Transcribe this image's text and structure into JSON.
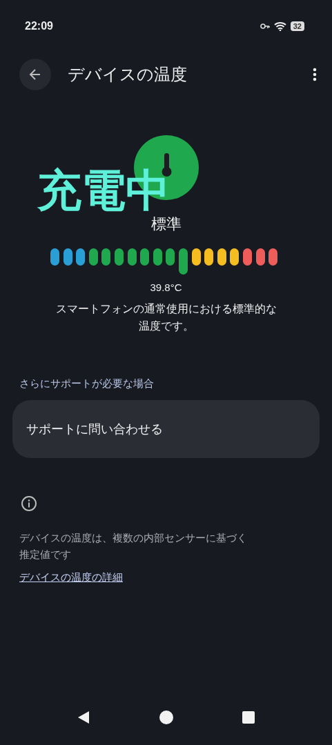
{
  "status_bar": {
    "time": "22:09",
    "battery": "32"
  },
  "header": {
    "title": "デバイスの温度"
  },
  "overlay_text": "充電中",
  "status": {
    "label": "標準",
    "reading": "39.8°C",
    "description": "スマートフォンの通常使用における標準的な温度です。"
  },
  "gauge": [
    {
      "color": "#2a9fd6",
      "selected": false
    },
    {
      "color": "#2a9fd6",
      "selected": false
    },
    {
      "color": "#2a9fd6",
      "selected": false
    },
    {
      "color": "#1fa84e",
      "selected": false
    },
    {
      "color": "#1fa84e",
      "selected": false
    },
    {
      "color": "#1fa84e",
      "selected": false
    },
    {
      "color": "#1fa84e",
      "selected": false
    },
    {
      "color": "#1fa84e",
      "selected": false
    },
    {
      "color": "#1fa84e",
      "selected": false
    },
    {
      "color": "#1fa84e",
      "selected": false
    },
    {
      "color": "#1fa84e",
      "selected": true
    },
    {
      "color": "#f5bd1f",
      "selected": false
    },
    {
      "color": "#f5bd1f",
      "selected": false
    },
    {
      "color": "#f5bd1f",
      "selected": false
    },
    {
      "color": "#f5bd1f",
      "selected": false
    },
    {
      "color": "#ee5d5a",
      "selected": false
    },
    {
      "color": "#ee5d5a",
      "selected": false
    },
    {
      "color": "#ee5d5a",
      "selected": false
    }
  ],
  "support": {
    "heading": "さらにサポートが必要な場合",
    "button": "サポートに問い合わせる"
  },
  "info": {
    "text": "デバイスの温度は、複数の内部センサーに基づく推定値です",
    "link": "デバイスの温度の詳細"
  }
}
